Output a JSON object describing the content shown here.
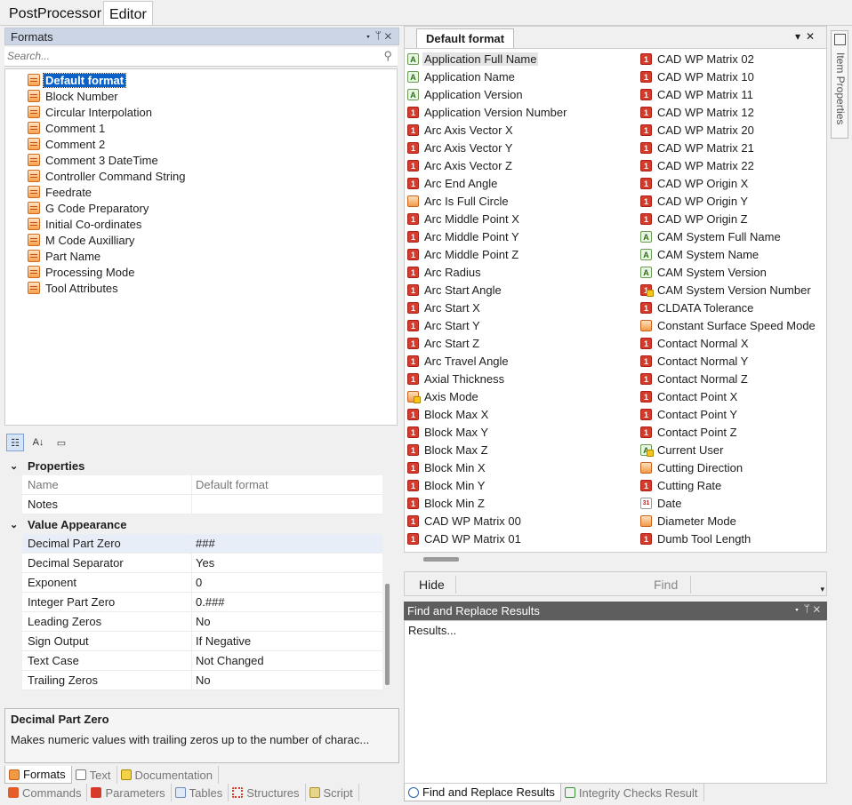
{
  "tabs": [
    "PostProcessor",
    "Editor"
  ],
  "formats_pane": {
    "title": "Formats",
    "search_placeholder": "Search...",
    "items": [
      "Default format",
      "Block Number",
      "Circular Interpolation",
      "Comment 1",
      "Comment 2",
      "Comment 3 DateTime",
      "Controller Command String",
      "Feedrate",
      "G Code Preparatory",
      "Initial Co-ordinates",
      "M Code Auxilliary",
      "Part Name",
      "Processing Mode",
      "Tool Attributes"
    ],
    "selected": "Default format"
  },
  "property_grid": {
    "categories": [
      {
        "name": "Properties",
        "rows": [
          {
            "key": "Name",
            "value": "Default format"
          },
          {
            "key": "Notes",
            "value": ""
          }
        ]
      },
      {
        "name": "Value Appearance",
        "rows": [
          {
            "key": "Decimal Part Zero",
            "value": "###"
          },
          {
            "key": "Decimal Separator",
            "value": "Yes"
          },
          {
            "key": "Exponent",
            "value": "0"
          },
          {
            "key": "Integer Part Zero",
            "value": "0.###"
          },
          {
            "key": "Leading Zeros",
            "value": "No"
          },
          {
            "key": "Sign Output",
            "value": "If Negative"
          },
          {
            "key": "Text Case",
            "value": "Not Changed"
          },
          {
            "key": "Trailing Zeros",
            "value": "No"
          }
        ]
      }
    ],
    "description_title": "Decimal Part Zero",
    "description_text": "Makes numeric values with trailing zeros up to the number of charac..."
  },
  "left_bottom_tabs_row1": [
    "Formats",
    "Text",
    "Documentation"
  ],
  "left_bottom_tabs_row2": [
    "Commands",
    "Parameters",
    "Tables",
    "Structures",
    "Script"
  ],
  "symbol_list": {
    "tab": "Default format",
    "col1": [
      {
        "label": "Application Full Name",
        "icon": "str"
      },
      {
        "label": "Application Name",
        "icon": "str"
      },
      {
        "label": "Application Version",
        "icon": "str"
      },
      {
        "label": "Application Version Number",
        "icon": "num"
      },
      {
        "label": "Arc Axis Vector X",
        "icon": "num"
      },
      {
        "label": "Arc Axis Vector Y",
        "icon": "num"
      },
      {
        "label": "Arc Axis Vector Z",
        "icon": "num"
      },
      {
        "label": "Arc End Angle",
        "icon": "num"
      },
      {
        "label": "Arc Is Full Circle",
        "icon": "fmt"
      },
      {
        "label": "Arc Middle Point X",
        "icon": "num"
      },
      {
        "label": "Arc Middle Point Y",
        "icon": "num"
      },
      {
        "label": "Arc Middle Point Z",
        "icon": "num"
      },
      {
        "label": "Arc Radius",
        "icon": "num"
      },
      {
        "label": "Arc Start Angle",
        "icon": "num"
      },
      {
        "label": "Arc Start X",
        "icon": "num"
      },
      {
        "label": "Arc Start Y",
        "icon": "num"
      },
      {
        "label": "Arc Start Z",
        "icon": "num"
      },
      {
        "label": "Arc Travel Angle",
        "icon": "num"
      },
      {
        "label": "Axial Thickness",
        "icon": "num"
      },
      {
        "label": "Axis Mode",
        "icon": "fmt-lock"
      },
      {
        "label": "Block Max X",
        "icon": "num"
      },
      {
        "label": "Block Max Y",
        "icon": "num"
      },
      {
        "label": "Block Max Z",
        "icon": "num"
      },
      {
        "label": "Block Min X",
        "icon": "num"
      },
      {
        "label": "Block Min Y",
        "icon": "num"
      },
      {
        "label": "Block Min Z",
        "icon": "num"
      },
      {
        "label": "CAD WP Matrix 00",
        "icon": "num"
      },
      {
        "label": "CAD WP Matrix 01",
        "icon": "num"
      }
    ],
    "col2": [
      {
        "label": "CAD WP Matrix 02",
        "icon": "num"
      },
      {
        "label": "CAD WP Matrix 10",
        "icon": "num"
      },
      {
        "label": "CAD WP Matrix 11",
        "icon": "num"
      },
      {
        "label": "CAD WP Matrix 12",
        "icon": "num"
      },
      {
        "label": "CAD WP Matrix 20",
        "icon": "num"
      },
      {
        "label": "CAD WP Matrix 21",
        "icon": "num"
      },
      {
        "label": "CAD WP Matrix 22",
        "icon": "num"
      },
      {
        "label": "CAD WP Origin X",
        "icon": "num"
      },
      {
        "label": "CAD WP Origin Y",
        "icon": "num"
      },
      {
        "label": "CAD WP Origin Z",
        "icon": "num"
      },
      {
        "label": "CAM System Full Name",
        "icon": "str"
      },
      {
        "label": "CAM System Name",
        "icon": "str"
      },
      {
        "label": "CAM System Version",
        "icon": "str"
      },
      {
        "label": "CAM System Version Number",
        "icon": "num-lock"
      },
      {
        "label": "CLDATA Tolerance",
        "icon": "num"
      },
      {
        "label": "Constant Surface Speed Mode",
        "icon": "fmt"
      },
      {
        "label": "Contact Normal X",
        "icon": "num"
      },
      {
        "label": "Contact Normal Y",
        "icon": "num"
      },
      {
        "label": "Contact Normal Z",
        "icon": "num"
      },
      {
        "label": "Contact Point X",
        "icon": "num"
      },
      {
        "label": "Contact Point Y",
        "icon": "num"
      },
      {
        "label": "Contact Point Z",
        "icon": "num"
      },
      {
        "label": "Current User",
        "icon": "str-lock"
      },
      {
        "label": "Cutting Direction",
        "icon": "fmt"
      },
      {
        "label": "Cutting Rate",
        "icon": "num"
      },
      {
        "label": "Date",
        "icon": "date"
      },
      {
        "label": "Diameter Mode",
        "icon": "fmt"
      },
      {
        "label": "Dumb Tool Length",
        "icon": "num"
      }
    ],
    "selected": "Application Full Name"
  },
  "find_bar": {
    "hide": "Hide",
    "find": "Find"
  },
  "find_results": {
    "title": "Find and Replace Results",
    "text": "Results..."
  },
  "right_bottom_tabs": [
    "Find and Replace Results",
    "Integrity Checks Result"
  ],
  "side_panel": "Item Properties"
}
